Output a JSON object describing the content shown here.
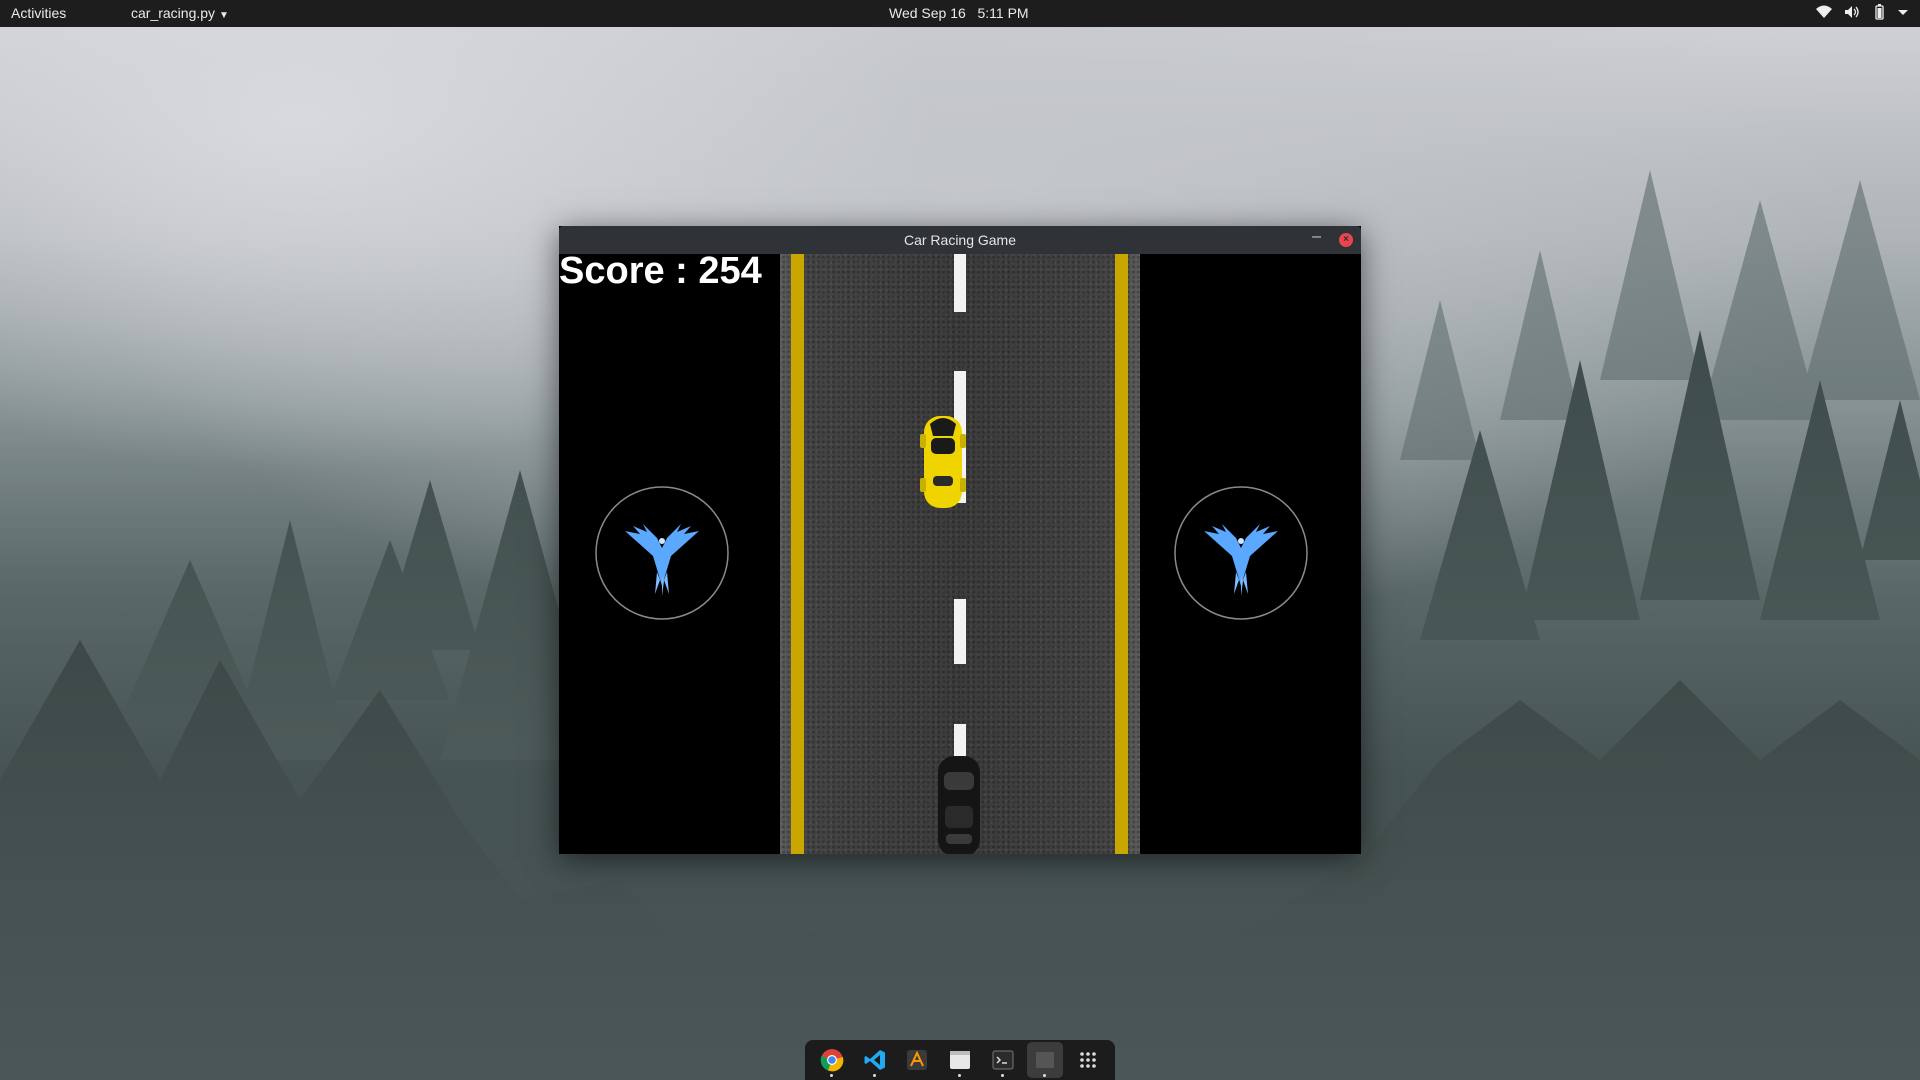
{
  "topbar": {
    "activities": "Activities",
    "app_menu": "car_racing.py",
    "date": "Wed Sep 16",
    "time": "5:11 PM",
    "tray_icons": [
      "wifi-icon",
      "volume-icon",
      "battery-icon",
      "system-menu-caret-icon"
    ]
  },
  "window": {
    "title": "Car Racing Game",
    "minimize_glyph": "–",
    "close_glyph": "×"
  },
  "game": {
    "score_text": "Score : 254",
    "colors": {
      "lane_line": "#c9a600",
      "dash": "#f2f2f2",
      "player_car": "#f0d400",
      "enemy_car": "#1a1a1a",
      "emblem_bird": "#5aa8ff"
    },
    "icons": [
      "bird-emblem-icon",
      "player-car-icon",
      "enemy-car-icon"
    ]
  },
  "dock": {
    "items": [
      {
        "name": "chrome",
        "icon": "chrome-icon",
        "running": true
      },
      {
        "name": "vscode",
        "icon": "vscode-icon",
        "running": true
      },
      {
        "name": "sublime",
        "icon": "sublime-icon",
        "running": false
      },
      {
        "name": "files",
        "icon": "files-icon",
        "running": true
      },
      {
        "name": "terminal",
        "icon": "terminal-icon",
        "running": true
      },
      {
        "name": "game",
        "icon": "game-window-icon",
        "running": true
      },
      {
        "name": "show-apps",
        "icon": "grid-icon",
        "running": false
      }
    ]
  }
}
